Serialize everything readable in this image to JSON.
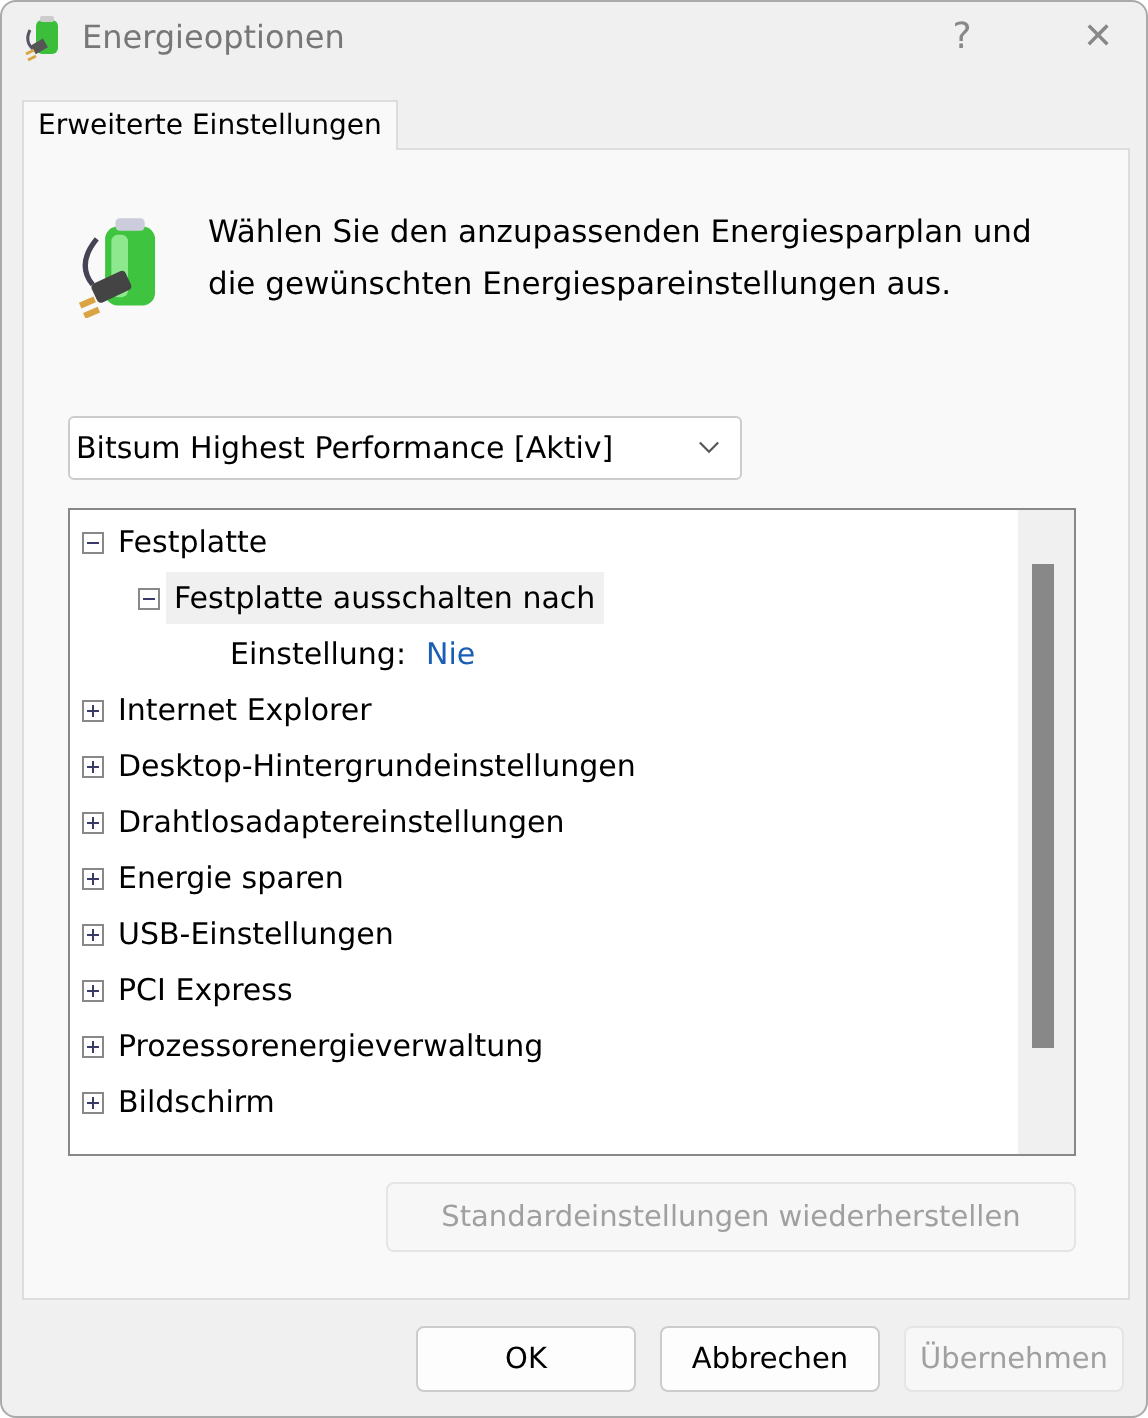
{
  "window": {
    "title": "Energieoptionen",
    "help": "?",
    "close": "✕"
  },
  "tabs": [
    {
      "label": "Erweiterte Einstellungen",
      "selected": true
    }
  ],
  "intro": "Wählen Sie den anzupassenden Energiesparplan und die gewünschten Energiespareinstellungen aus.",
  "plan_dropdown": {
    "value": "Bitsum Highest Performance [Aktiv]"
  },
  "tree": [
    {
      "kind": "node",
      "label": "Festplatte",
      "expanded": true,
      "selected": false,
      "children": [
        {
          "kind": "node",
          "label": "Festplatte ausschalten nach",
          "expanded": true,
          "selected": true,
          "children": [
            {
              "kind": "setting",
              "label": "Einstellung:",
              "value": "Nie"
            }
          ]
        }
      ]
    },
    {
      "kind": "node",
      "label": "Internet Explorer",
      "expanded": false,
      "selected": false
    },
    {
      "kind": "node",
      "label": "Desktop-Hintergrundeinstellungen",
      "expanded": false,
      "selected": false
    },
    {
      "kind": "node",
      "label": "Drahtlosadaptereinstellungen",
      "expanded": false,
      "selected": false
    },
    {
      "kind": "node",
      "label": "Energie sparen",
      "expanded": false,
      "selected": false
    },
    {
      "kind": "node",
      "label": "USB-Einstellungen",
      "expanded": false,
      "selected": false
    },
    {
      "kind": "node",
      "label": "PCI Express",
      "expanded": false,
      "selected": false
    },
    {
      "kind": "node",
      "label": "Prozessorenergieverwaltung",
      "expanded": false,
      "selected": false
    },
    {
      "kind": "node",
      "label": "Bildschirm",
      "expanded": false,
      "selected": false
    }
  ],
  "restore_button": {
    "label": "Standardeinstellungen wiederherstellen",
    "disabled": true
  },
  "buttons": [
    {
      "label": "OK",
      "disabled": false
    },
    {
      "label": "Abbrechen",
      "disabled": false
    },
    {
      "label": "Übernehmen",
      "disabled": true
    }
  ]
}
